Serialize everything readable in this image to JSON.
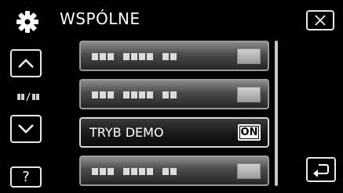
{
  "header": {
    "title": "WSPÓLNE",
    "icon": "gear-icon"
  },
  "items": [
    {
      "label": "",
      "value": "",
      "active": false
    },
    {
      "label": "",
      "value": "",
      "active": false
    },
    {
      "label": "TRYB DEMO",
      "value": "ON",
      "active": true
    },
    {
      "label": "",
      "value": "",
      "active": false
    }
  ],
  "controls": {
    "help_label": "?",
    "close_icon": "close-icon",
    "back_icon": "back-icon",
    "up_icon": "chevron-up-icon",
    "down_icon": "chevron-down-icon"
  },
  "colors": {
    "background": "#000000",
    "item_active": "#161616",
    "item_inactive": "#4a4a4a",
    "border": "#e8e8e8"
  }
}
